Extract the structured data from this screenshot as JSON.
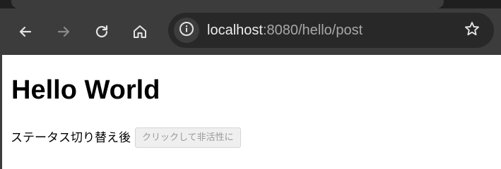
{
  "browser": {
    "url_host": "localhost",
    "url_rest": ":8080/hello/post",
    "icons": {
      "back": "arrow-left-icon",
      "forward": "arrow-right-icon",
      "reload": "reload-icon",
      "home": "home-icon",
      "site_info": "info-icon",
      "bookmark": "star-icon"
    },
    "colors": {
      "toolbar": "#3c3c3c",
      "omnibox": "#282828",
      "icon": "#e3e3e3",
      "icon_disabled": "#8a8a8a"
    }
  },
  "page": {
    "heading": "Hello World",
    "status_label": "ステータス切り替え後",
    "button_label": "クリックして非活性に",
    "button_disabled": true
  }
}
